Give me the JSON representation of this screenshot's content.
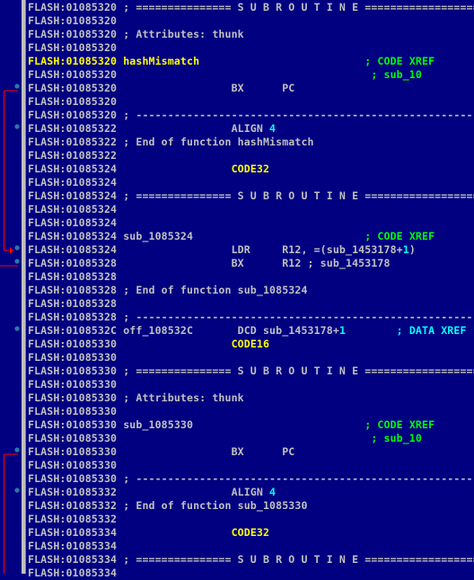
{
  "window": {
    "type": "disassembly-listing",
    "segment": "FLASH"
  },
  "colors": {
    "background": "#000080",
    "text": "#c0c0c0",
    "highlight": "#ffff00",
    "number": "#00ffff",
    "code_xref_comment": "#00ff00",
    "data_xref_comment": "#00ffff",
    "flow_arrow": "#ff0000",
    "flow_dot": "#2a7aa8"
  },
  "rows": [
    {
      "addr": "FLASH:01085320",
      "parts": [
        {
          "t": " ; =============== S U B R O U T I N E ================================"
        }
      ]
    },
    {
      "addr": "FLASH:01085320",
      "parts": []
    },
    {
      "addr": "FLASH:01085320",
      "parts": [
        {
          "t": " ; Attributes: thunk"
        }
      ]
    },
    {
      "addr": "FLASH:01085320",
      "parts": []
    },
    {
      "addr": "FLASH:01085320",
      "hl": true,
      "parts": [
        {
          "t": " hashMismatch",
          "c": "yel"
        },
        {
          "t": "                          "
        },
        {
          "t": "; CODE XREF",
          "c": "green"
        }
      ]
    },
    {
      "addr": "FLASH:01085320",
      "parts": [
        {
          "t": "                                        "
        },
        {
          "t": "; sub_10",
          "c": "green"
        }
      ]
    },
    {
      "addr": "FLASH:01085320",
      "parts": [
        {
          "t": "                  BX      PC"
        }
      ]
    },
    {
      "addr": "FLASH:01085320",
      "parts": []
    },
    {
      "addr": "FLASH:01085320",
      "parts": [
        {
          "t": " ; ---------------------------------------------------------------------"
        }
      ]
    },
    {
      "addr": "FLASH:01085322",
      "parts": [
        {
          "t": "                  ALIGN "
        },
        {
          "t": "4",
          "c": "cyan"
        }
      ]
    },
    {
      "addr": "FLASH:01085322",
      "parts": [
        {
          "t": " ; End of function hashMismatch"
        }
      ]
    },
    {
      "addr": "FLASH:01085322",
      "parts": []
    },
    {
      "addr": "FLASH:01085324",
      "parts": [
        {
          "t": "                  "
        },
        {
          "t": "CODE32",
          "c": "yel"
        }
      ]
    },
    {
      "addr": "FLASH:01085324",
      "parts": []
    },
    {
      "addr": "FLASH:01085324",
      "parts": [
        {
          "t": " ; =============== S U B R O U T I N E ================================"
        }
      ]
    },
    {
      "addr": "FLASH:01085324",
      "parts": []
    },
    {
      "addr": "FLASH:01085324",
      "parts": []
    },
    {
      "addr": "FLASH:01085324",
      "parts": [
        {
          "t": " sub_1085324"
        },
        {
          "t": "                           "
        },
        {
          "t": "; CODE XREF",
          "c": "green"
        }
      ]
    },
    {
      "addr": "FLASH:01085324",
      "parts": [
        {
          "t": "                  LDR     R12, =(sub_1453178+"
        },
        {
          "t": "1",
          "c": "cyan"
        },
        {
          "t": ")"
        }
      ]
    },
    {
      "addr": "FLASH:01085328",
      "parts": [
        {
          "t": "                  BX      R12 ; sub_1453178"
        }
      ]
    },
    {
      "addr": "FLASH:01085328",
      "parts": []
    },
    {
      "addr": "FLASH:01085328",
      "parts": [
        {
          "t": " ; End of function sub_1085324"
        }
      ]
    },
    {
      "addr": "FLASH:01085328",
      "parts": []
    },
    {
      "addr": "FLASH:01085328",
      "parts": [
        {
          "t": " ; ---------------------------------------------------------------------"
        }
      ]
    },
    {
      "addr": "FLASH:0108532C",
      "parts": [
        {
          "t": " off_108532C       DCD sub_1453178+"
        },
        {
          "t": "1",
          "c": "cyan"
        },
        {
          "t": "        "
        },
        {
          "t": "; DATA XREF",
          "c": "ccyan"
        }
      ]
    },
    {
      "addr": "FLASH:01085330",
      "parts": [
        {
          "t": "                  "
        },
        {
          "t": "CODE16",
          "c": "yel"
        }
      ]
    },
    {
      "addr": "FLASH:01085330",
      "parts": []
    },
    {
      "addr": "FLASH:01085330",
      "parts": [
        {
          "t": " ; =============== S U B R O U T I N E ================================"
        }
      ]
    },
    {
      "addr": "FLASH:01085330",
      "parts": []
    },
    {
      "addr": "FLASH:01085330",
      "parts": [
        {
          "t": " ; Attributes: thunk"
        }
      ]
    },
    {
      "addr": "FLASH:01085330",
      "parts": []
    },
    {
      "addr": "FLASH:01085330",
      "parts": [
        {
          "t": " sub_1085330"
        },
        {
          "t": "                           "
        },
        {
          "t": "; CODE XREF",
          "c": "green"
        }
      ]
    },
    {
      "addr": "FLASH:01085330",
      "parts": [
        {
          "t": "                                        "
        },
        {
          "t": "; sub_10",
          "c": "green"
        }
      ]
    },
    {
      "addr": "FLASH:01085330",
      "parts": [
        {
          "t": "                  BX      PC"
        }
      ]
    },
    {
      "addr": "FLASH:01085330",
      "parts": []
    },
    {
      "addr": "FLASH:01085330",
      "parts": [
        {
          "t": " ; ---------------------------------------------------------------------"
        }
      ]
    },
    {
      "addr": "FLASH:01085332",
      "parts": [
        {
          "t": "                  ALIGN "
        },
        {
          "t": "4",
          "c": "cyan"
        }
      ]
    },
    {
      "addr": "FLASH:01085332",
      "parts": [
        {
          "t": " ; End of function sub_1085330"
        }
      ]
    },
    {
      "addr": "FLASH:01085332",
      "parts": []
    },
    {
      "addr": "FLASH:01085334",
      "parts": [
        {
          "t": "                  "
        },
        {
          "t": "CODE32",
          "c": "yel"
        }
      ]
    },
    {
      "addr": "FLASH:01085334",
      "parts": []
    },
    {
      "addr": "FLASH:01085334",
      "parts": [
        {
          "t": " ; =============== S U B R O U T I N E ================================"
        }
      ]
    },
    {
      "addr": "FLASH:01085334",
      "parts": []
    }
  ],
  "gutter": {
    "dots_at_rows": [
      6,
      9,
      18,
      19,
      24,
      33,
      36
    ],
    "arrows": [
      {
        "from_row": 6,
        "to_row": 18,
        "direction": "down",
        "icon": "flow-arrow-icon"
      },
      {
        "from_row": 19,
        "to_row": null,
        "direction": "out-left",
        "icon": "flow-line-icon"
      },
      {
        "from_row": 33,
        "to_row": null,
        "direction": "down-offscreen",
        "icon": "flow-line-icon"
      }
    ]
  }
}
